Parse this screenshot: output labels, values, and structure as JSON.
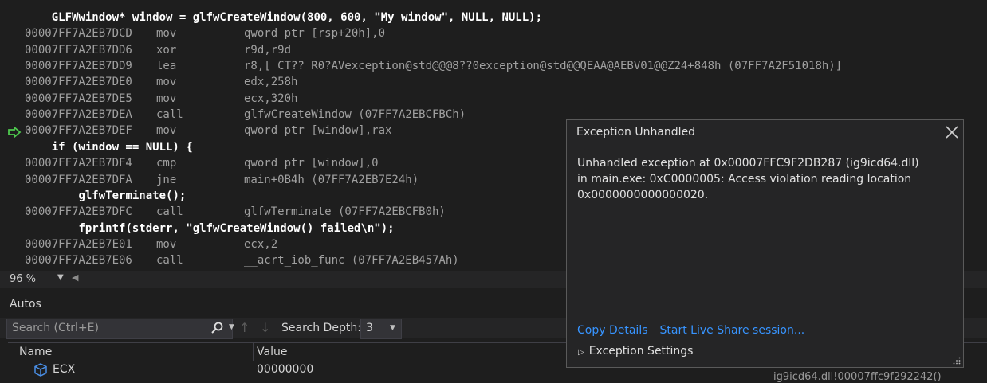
{
  "disassembly": {
    "lines": [
      {
        "kind": "src",
        "indent": "    ",
        "text": "GLFWwindow* window = glfwCreateWindow(800, 600, \"My window\", NULL, NULL);"
      },
      {
        "kind": "asm",
        "addr": "00007FF7A2EB7DCD",
        "mn": "mov",
        "op": "qword ptr [rsp+20h],0"
      },
      {
        "kind": "asm",
        "addr": "00007FF7A2EB7DD6",
        "mn": "xor",
        "op": "r9d,r9d"
      },
      {
        "kind": "asm",
        "addr": "00007FF7A2EB7DD9",
        "mn": "lea",
        "op": "r8,[_CT??_R0?AVexception@std@@@8??0exception@std@@QEAA@AEBV01@@Z24+848h (07FF7A2F51018h)]"
      },
      {
        "kind": "asm",
        "addr": "00007FF7A2EB7DE0",
        "mn": "mov",
        "op": "edx,258h"
      },
      {
        "kind": "asm",
        "addr": "00007FF7A2EB7DE5",
        "mn": "mov",
        "op": "ecx,320h"
      },
      {
        "kind": "asm",
        "addr": "00007FF7A2EB7DEA",
        "mn": "call",
        "op": "glfwCreateWindow (07FF7A2EBCFBCh)"
      },
      {
        "kind": "asm",
        "addr": "00007FF7A2EB7DEF",
        "mn": "mov",
        "op": "qword ptr [window],rax"
      },
      {
        "kind": "src",
        "indent": "    ",
        "text": "if (window == NULL) {"
      },
      {
        "kind": "asm",
        "addr": "00007FF7A2EB7DF4",
        "mn": "cmp",
        "op": "qword ptr [window],0"
      },
      {
        "kind": "asm",
        "addr": "00007FF7A2EB7DFA",
        "mn": "jne",
        "op": "main+0B4h (07FF7A2EB7E24h)"
      },
      {
        "kind": "src",
        "indent": "        ",
        "text": "glfwTerminate();"
      },
      {
        "kind": "asm",
        "addr": "00007FF7A2EB7DFC",
        "mn": "call",
        "op": "glfwTerminate (07FF7A2EBCFB0h)"
      },
      {
        "kind": "src",
        "indent": "        ",
        "text": "fprintf(stderr, \"glfwCreateWindow() failed\\n\");"
      },
      {
        "kind": "asm",
        "addr": "00007FF7A2EB7E01",
        "mn": "mov",
        "op": "ecx,2"
      },
      {
        "kind": "asm",
        "addr": "00007FF7A2EB7E06",
        "mn": "call",
        "op": "__acrt_iob_func (07FF7A2EB457Ah)"
      }
    ],
    "current_line_index": 7,
    "current_line_icon": "next-statement-arrow-icon"
  },
  "zoom": {
    "level": "96 %"
  },
  "autos": {
    "title": "Autos",
    "search_placeholder": "Search (Ctrl+E)",
    "search_depth_label": "Search Depth:",
    "search_depth_value": "3",
    "columns": {
      "name": "Name",
      "value": "Value"
    },
    "rows": [
      {
        "name": "ECX",
        "value": "00000000",
        "icon": "cube-icon"
      }
    ]
  },
  "background_text": "ig9icd64.dll!00007ffc9f292242()",
  "exception_popup": {
    "title": "Exception Unhandled",
    "message": "Unhandled exception at 0x00007FFC9F2DB287 (ig9icd64.dll) in main.exe: 0xC0000005: Access violation reading location 0x0000000000000020.",
    "copy_details": "Copy Details",
    "live_share": "Start Live Share session...",
    "settings": "Exception Settings"
  },
  "colors": {
    "accent_link": "#3794ff",
    "arrow_green": "#4ec94e"
  }
}
